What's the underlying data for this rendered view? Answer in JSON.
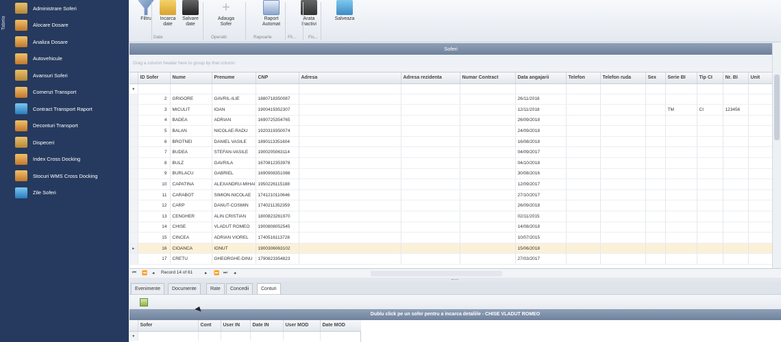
{
  "nav": {
    "vertical_label": "Tabela",
    "items": [
      {
        "label": "Administrare Soferi",
        "icon": "drivers-admin-icon",
        "style": "ni-a"
      },
      {
        "label": "Alocare Dosare",
        "icon": "folder-allocate-icon",
        "style": "ni-b"
      },
      {
        "label": "Analiza Dosare",
        "icon": "folder-analysis-icon",
        "style": "ni-b"
      },
      {
        "label": "Autovehicule",
        "icon": "truck-icon",
        "style": "ni-b"
      },
      {
        "label": "Avansuri Soferi",
        "icon": "advance-money-icon",
        "style": "ni-a"
      },
      {
        "label": "Comenzi Transport",
        "icon": "transport-order-icon",
        "style": "ni-b"
      },
      {
        "label": "Contract Transport Raport",
        "icon": "contract-report-icon",
        "style": "ni-c"
      },
      {
        "label": "Deconturi Transport",
        "icon": "settlement-icon",
        "style": "ni-b"
      },
      {
        "label": "Dispeceri",
        "icon": "dispatcher-icon",
        "style": "ni-a"
      },
      {
        "label": "Index Cross Docking",
        "icon": "cross-docking-icon",
        "style": "ni-b"
      },
      {
        "label": "Stocuri WMS Cross Docking",
        "icon": "stock-wms-icon",
        "style": "ni-b"
      },
      {
        "label": "Zile Soferi",
        "icon": "driver-days-icon",
        "style": "ni-c"
      }
    ]
  },
  "ribbon": {
    "buttons": [
      {
        "name": "filter-button",
        "label": "Filtru",
        "icon": "filter-icon",
        "cls": "ric-filter"
      },
      {
        "name": "load-data-button",
        "label": "Incarca\ndate",
        "icon": "load-data-icon",
        "cls": "ric-load"
      },
      {
        "name": "save-data-button",
        "label": "Salvare\ndate",
        "icon": "save-disk-icon",
        "cls": "ric-save"
      },
      {
        "name": "add-driver-button",
        "label": "Adauga\nSofer",
        "icon": "add-driver-icon",
        "cls": "ric-add"
      },
      {
        "name": "auto-report-button",
        "label": "Raport\nAutomat",
        "icon": "report-icon",
        "cls": "ric-rep"
      },
      {
        "name": "show-inactive-button",
        "label": "Arata\nInactivi",
        "icon": "inactive-icon",
        "cls": "ric-arata"
      },
      {
        "name": "save-button",
        "label": "Salveaza",
        "icon": "save-icon",
        "cls": "ric-salv"
      }
    ],
    "groups": [
      "Date",
      "Operatii",
      "Rapoarte",
      "Fil...",
      "Fis..."
    ]
  },
  "grid": {
    "title": "Soferi",
    "groupby_hint": "Drag a column header here to group by that column",
    "columns": [
      "ID Sofer",
      "Nume",
      "Prenume",
      "CNP",
      "Adresa",
      "Adresa rezidenta",
      "Numar Contract",
      "Data angajarii",
      "Telefon",
      "Telefon ruda",
      "Sex",
      "Serie BI",
      "Tip CI",
      "Nr. BI",
      "Unit"
    ],
    "rows": [
      [
        "",
        "",
        "",
        "",
        "",
        "",
        "",
        "",
        "",
        "",
        "",
        "",
        "",
        "",
        ""
      ],
      [
        "2",
        "GRIGORE",
        "GAVRIL-ILIE",
        "1880718350087",
        "",
        "",
        "",
        "26/11/2018",
        "",
        "",
        "",
        "",
        "",
        "",
        ""
      ],
      [
        "3",
        "MICULIT",
        "IOAN",
        "1900419352307",
        "",
        "",
        "",
        "12/11/2018",
        "",
        "",
        "",
        "TM",
        "CI",
        "123456",
        ""
      ],
      [
        "4",
        "BADEA",
        "ADRIAN",
        "1690725354765",
        "",
        "",
        "",
        "26/09/2018",
        "",
        "",
        "",
        "",
        "",
        "",
        ""
      ],
      [
        "5",
        "BALAN",
        "NICOLAE-RADU",
        "1920319350074",
        "",
        "",
        "",
        "24/09/2018",
        "",
        "",
        "",
        "",
        "",
        "",
        ""
      ],
      [
        "6",
        "BROTNEI",
        "DANIEL VASILE",
        "1890113351604",
        "",
        "",
        "",
        "16/08/2018",
        "",
        "",
        "",
        "",
        "",
        "",
        ""
      ],
      [
        "7",
        "BUDEA",
        "STEFAN-VASILE",
        "1900205063114",
        "",
        "",
        "",
        "04/09/2017",
        "",
        "",
        "",
        "",
        "",
        "",
        ""
      ],
      [
        "8",
        "BULZ",
        "GAVRILA",
        "1670812353978",
        "",
        "",
        "",
        "04/10/2018",
        "",
        "",
        "",
        "",
        "",
        "",
        ""
      ],
      [
        "9",
        "BURLACU",
        "GABRIEL",
        "1690908351086",
        "",
        "",
        "",
        "30/08/2016",
        "",
        "",
        "",
        "",
        "",
        "",
        ""
      ],
      [
        "10",
        "CAPATINA",
        "ALEXANDRU-MIHAI",
        "1950226115188",
        "",
        "",
        "",
        "12/09/2017",
        "",
        "",
        "",
        "",
        "",
        "",
        ""
      ],
      [
        "11",
        "CARABOT",
        "SIMION-NICOLAE",
        "1741210110646",
        "",
        "",
        "",
        "27/10/2017",
        "",
        "",
        "",
        "",
        "",
        "",
        ""
      ],
      [
        "12",
        "CARP",
        "DANUT-COSMIN",
        "1740211352359",
        "",
        "",
        "",
        "26/09/2018",
        "",
        "",
        "",
        "",
        "",
        "",
        ""
      ],
      [
        "13",
        "CENGHER",
        "ALIN CRISTIAN",
        "1800823261970",
        "",
        "",
        "",
        "02/11/2015",
        "",
        "",
        "",
        "",
        "",
        "",
        ""
      ],
      [
        "14",
        "CHISE",
        "VLADUT ROMEO",
        "1900808052545",
        "",
        "",
        "",
        "14/08/2018",
        "",
        "",
        "",
        "",
        "",
        "",
        ""
      ],
      [
        "15",
        "CINCEA",
        "ADRIAN VIOREL",
        "1740516113728",
        "",
        "",
        "",
        "10/07/2015",
        "",
        "",
        "",
        "",
        "",
        "",
        ""
      ],
      [
        "16",
        "CIOANCA",
        "IONUT",
        "1900306063102",
        "",
        "",
        "",
        "15/06/2018",
        "",
        "",
        "",
        "",
        "",
        "",
        ""
      ],
      [
        "17",
        "CRETU",
        "GHEORGHE-DINU",
        "1790823354823",
        "",
        "",
        "",
        "27/03/2017",
        "",
        "",
        "",
        "",
        "",
        "",
        ""
      ]
    ],
    "selected_row_index": 15,
    "record_text": "Record 14 of 61"
  },
  "detail": {
    "tabs": [
      "Evenimente",
      "Documente",
      "Rate",
      "Concedii",
      "Conturi"
    ],
    "active_tab": "Conturi",
    "title": "Dublu click pe un sofer pentru a incarca detaliile - CHISE VLADUT ROMEO",
    "columns": [
      "Sofer",
      "Cont",
      "User IN",
      "Date IN",
      "User MOD",
      "Date MOD"
    ]
  }
}
